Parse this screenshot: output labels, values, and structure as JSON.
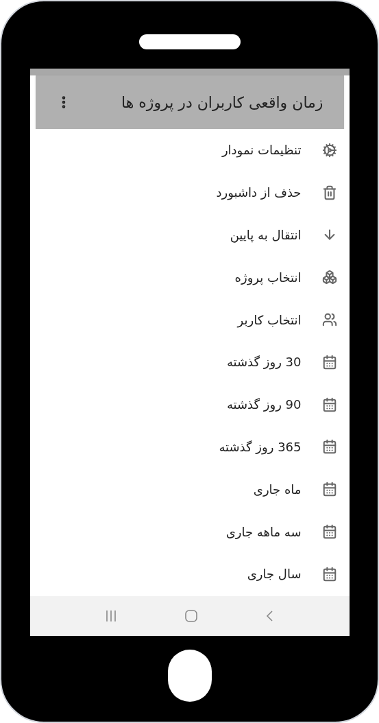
{
  "header": {
    "title": "زمان واقعی کاربران در پروژه ها"
  },
  "menu": [
    {
      "label": "تنظیمات نمودار",
      "kind": "gear"
    },
    {
      "label": "حذف از داشبورد",
      "kind": "trash"
    },
    {
      "label": "انتقال به پایین",
      "kind": "arrow-down"
    },
    {
      "label": "انتخاب پروژه",
      "kind": "cubes"
    },
    {
      "label": "انتخاب کاربر",
      "kind": "users"
    },
    {
      "label": "30 روز گذشته",
      "kind": "calendar"
    },
    {
      "label": "90 روز گذشته",
      "kind": "calendar"
    },
    {
      "label": "365 روز گذشته",
      "kind": "calendar"
    },
    {
      "label": "ماه جاری",
      "kind": "calendar"
    },
    {
      "label": "سه ماهه جاری",
      "kind": "calendar"
    },
    {
      "label": "سال جاری",
      "kind": "calendar"
    }
  ]
}
